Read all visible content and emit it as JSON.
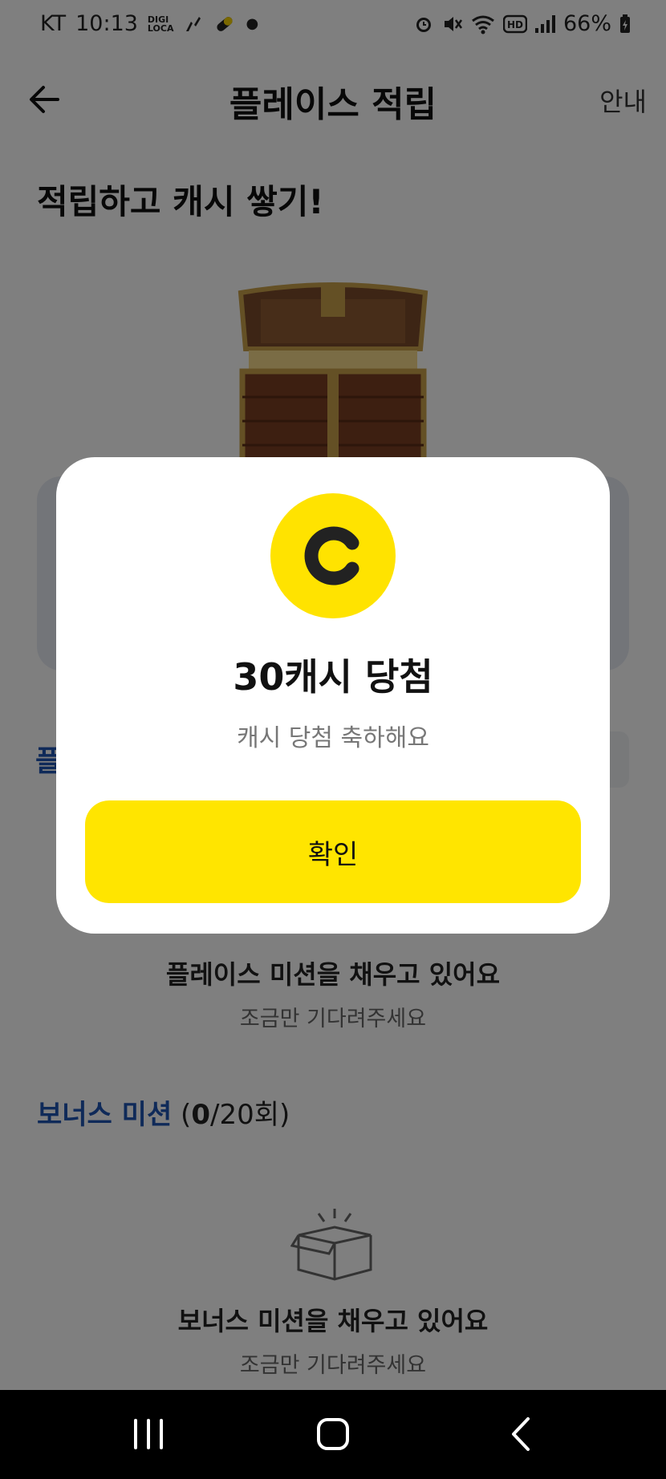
{
  "status_bar": {
    "carrier": "KT",
    "time": "10:13",
    "digi_line1": "DIGI",
    "digi_line2": "LOCA",
    "battery": "66%"
  },
  "header": {
    "title": "플레이스 적립",
    "guide_label": "안내"
  },
  "headline": "적립하고 캐시 쌓기!",
  "place_mission_peek": "플",
  "place_mission": {
    "title": "플레이스 미션을 채우고 있어요",
    "subtitle": "조금만 기다려주세요"
  },
  "bonus": {
    "label": "보너스 미션",
    "open": " (",
    "count": "0",
    "total": "/20회)"
  },
  "bonus_mission": {
    "title": "보너스 미션을 채우고 있어요",
    "subtitle": "조금만 기다려주세요"
  },
  "modal": {
    "coin_letter": "C",
    "title": "30캐시 당첨",
    "subtitle": "캐시 당첨 축하해요",
    "confirm_label": "확인"
  },
  "colors": {
    "accent_yellow": "#FFE500",
    "brand_blue": "#1E55B3"
  }
}
